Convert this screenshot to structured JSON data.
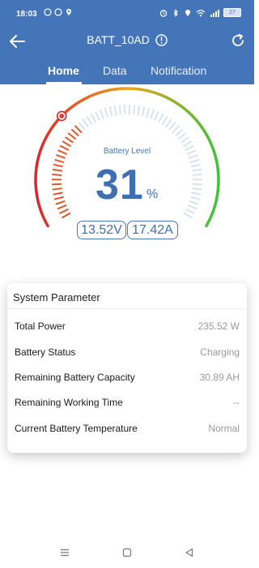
{
  "status_bar": {
    "time": "18:03",
    "battery_percent": "27",
    "icons_left": [
      "whatsapp-icon",
      "whatsapp-icon",
      "location-icon"
    ],
    "icons_right": [
      "alarm-icon",
      "bluetooth-icon",
      "location-icon",
      "wifi-icon",
      "signal-icon",
      "battery-icon"
    ]
  },
  "app_bar": {
    "title": "BATT_10AD",
    "background": "#4575b9",
    "tabs": [
      {
        "label": "Home",
        "active": true
      },
      {
        "label": "Data",
        "active": false
      },
      {
        "label": "Notification",
        "active": false
      }
    ]
  },
  "gauge": {
    "label": "Battery Level",
    "value": "31",
    "unit": "%",
    "level_fraction": 0.31,
    "voltage": "13.52V",
    "current": "17.42A",
    "colors": {
      "low": "#d9262c",
      "mid": "#f0a11c",
      "high": "#3cc23a",
      "inner_fill": "#e0572a",
      "inner_empty": "#d8e3f0"
    }
  },
  "system_parameter": {
    "title": "System Parameter",
    "rows": [
      {
        "label": "Total Power",
        "value": "235.52 W"
      },
      {
        "label": "Battery Status",
        "value": "Charging"
      },
      {
        "label": "Remaining Battery Capacity",
        "value": "30.89 AH"
      },
      {
        "label": "Remaining Working Time",
        "value": "--"
      },
      {
        "label": "Current Battery Temperature",
        "value": "Normal"
      }
    ]
  },
  "nav_bar": {
    "icons": [
      "menu-icon",
      "home-square-icon",
      "back-triangle-icon"
    ]
  }
}
